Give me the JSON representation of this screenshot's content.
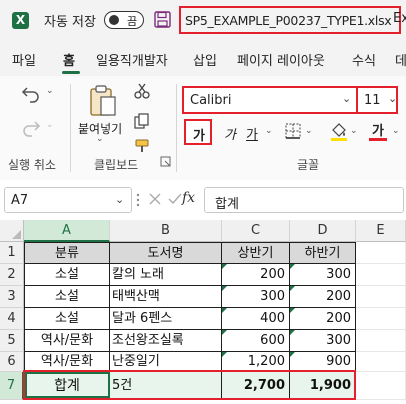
{
  "titlebar": {
    "logo": "X",
    "autosave_label": "자동 저장",
    "autosave_state": "끔",
    "filename": "SP5_EXAMPLE_P00237_TYPE1.xlsx",
    "app_suffix": "Exc"
  },
  "menu": {
    "tabs": [
      "파일",
      "홈",
      "일용직개발자",
      "삽입",
      "페이지 레이아웃",
      "수식",
      "데"
    ]
  },
  "ribbon": {
    "groups": {
      "undo": "실행 취소",
      "clipboard": "클립보드",
      "font": "글꼴"
    },
    "paste_label": "붙여넣기",
    "font_name": "Calibri",
    "font_size": "11",
    "bold": "가",
    "italic": "가",
    "underline": "가",
    "font_color_glyph": "가",
    "colors": {
      "accent": "#1e7145",
      "highlight_fill": "#ffe000",
      "font_color": "#e4202c",
      "callout_red": "#e4202c"
    }
  },
  "formula_bar": {
    "name_box": "A7",
    "fx": "fx",
    "formula": "합계"
  },
  "sheet": {
    "columns": [
      "A",
      "B",
      "C",
      "D",
      "E"
    ],
    "rows": [
      "1",
      "2",
      "3",
      "4",
      "5",
      "6",
      "7"
    ],
    "header": [
      "분류",
      "도서명",
      "상반기",
      "하반기"
    ],
    "data": [
      [
        "소설",
        "칼의 노래",
        "200",
        "300"
      ],
      [
        "소설",
        "태백산맥",
        "300",
        "200"
      ],
      [
        "소설",
        "달과 6펜스",
        "400",
        "200"
      ],
      [
        "역사/문화",
        "조선왕조실록",
        "600",
        "300"
      ],
      [
        "역사/문화",
        "난중일기",
        "1,200",
        "900"
      ]
    ],
    "total": [
      "합계",
      "5건",
      "2,700",
      "1,900"
    ],
    "selected_cell": "A7"
  }
}
